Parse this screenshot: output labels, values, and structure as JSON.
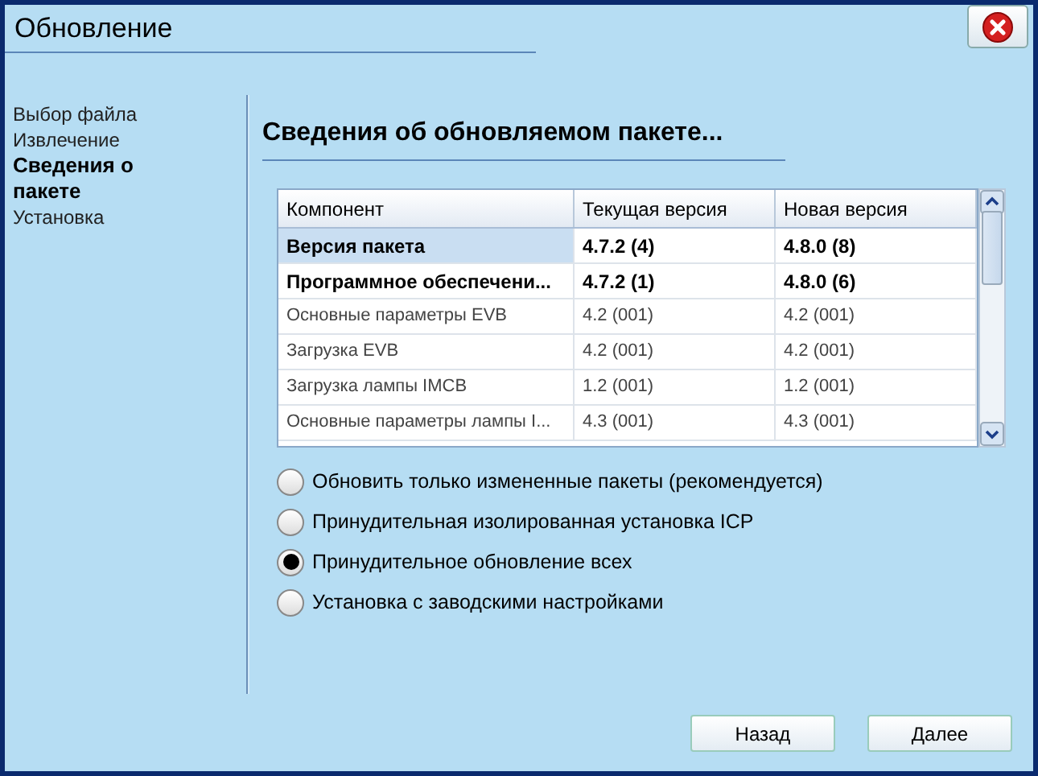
{
  "window": {
    "title": "Обновление"
  },
  "steps": [
    {
      "label": "Выбор файла",
      "selected": false
    },
    {
      "label": "Извлечение",
      "selected": false
    },
    {
      "label": "Сведения о пакете",
      "selected": true
    },
    {
      "label": "Установка",
      "selected": false
    }
  ],
  "heading": "Сведения об обновляемом пакете...",
  "table": {
    "columns": [
      "Компонент",
      "Текущая версия",
      "Новая версия"
    ],
    "rows": [
      {
        "cells": [
          "Версия пакета",
          "4.7.2 (4)",
          "4.8.0 (8)"
        ],
        "bold": true,
        "selected": true
      },
      {
        "cells": [
          "Программное обеспечени...",
          "4.7.2 (1)",
          "4.8.0 (6)"
        ],
        "bold": true,
        "selected": false
      },
      {
        "cells": [
          "Основные параметры EVB",
          "4.2 (001)",
          "4.2 (001)"
        ],
        "bold": false,
        "selected": false
      },
      {
        "cells": [
          "Загрузка EVB",
          "4.2 (001)",
          "4.2 (001)"
        ],
        "bold": false,
        "selected": false
      },
      {
        "cells": [
          "Загрузка лампы IMCB",
          "1.2 (001)",
          "1.2 (001)"
        ],
        "bold": false,
        "selected": false
      },
      {
        "cells": [
          "Основные параметры лампы I...",
          "4.3 (001)",
          "4.3 (001)"
        ],
        "bold": false,
        "selected": false
      }
    ]
  },
  "options": [
    {
      "label": "Обновить только измененные пакеты (рекомендуется)",
      "selected": false
    },
    {
      "label": "Принудительная изолированная установка ICP",
      "selected": false
    },
    {
      "label": "Принудительное обновление всех",
      "selected": true
    },
    {
      "label": "Установка с заводскими настройками",
      "selected": false
    }
  ],
  "buttons": [
    "Назад",
    "Далее"
  ]
}
